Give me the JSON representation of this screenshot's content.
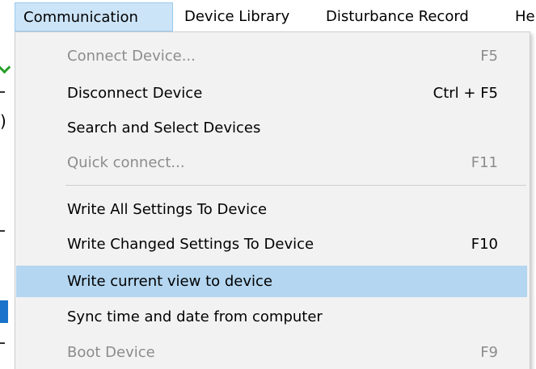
{
  "menubar": {
    "items": [
      {
        "label": "Communication"
      },
      {
        "label": "Device Library"
      },
      {
        "label": "Disturbance Record"
      },
      {
        "label": "He"
      }
    ]
  },
  "menu": {
    "items": [
      {
        "label": "Connect Device...",
        "shortcut": "F5",
        "enabled": false
      },
      {
        "label": "Disconnect Device",
        "shortcut": "Ctrl + F5",
        "enabled": true
      },
      {
        "label": "Search and Select Devices",
        "shortcut": "",
        "enabled": true
      },
      {
        "label": "Quick connect...",
        "shortcut": "F11",
        "enabled": false
      },
      {
        "label": "Write All Settings To Device",
        "shortcut": "",
        "enabled": true
      },
      {
        "label": "Write Changed Settings To Device",
        "shortcut": "F10",
        "enabled": true
      },
      {
        "label": "Write current view to device",
        "shortcut": "",
        "enabled": true,
        "highlighted": true
      },
      {
        "label": "Sync time and date from computer",
        "shortcut": "",
        "enabled": true
      },
      {
        "label": "Boot Device",
        "shortcut": "F9",
        "enabled": false
      }
    ]
  },
  "background": {
    "fragment_1": ")"
  },
  "colors": {
    "menubar_active_bg": "#cce4f7",
    "menu_bg": "#f2f2f2",
    "highlight_bg": "#b4d6f0",
    "disabled_text": "#8c8c8c"
  }
}
